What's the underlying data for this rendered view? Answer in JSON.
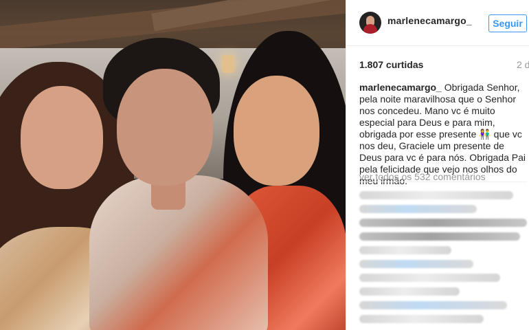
{
  "post": {
    "username": "marlenecamargo_",
    "follow_label": "Seguir",
    "likes_label": "1.807 curtidas",
    "date_label": "2 d",
    "caption_username": "marlenecamargo_",
    "caption_text": " Obrigada Senhor, pela noite maravilhosa que o Senhor nos concedeu. Mano vc é muito especial para Deus e para mim, obrigada por esse presente 👫 que vc nos deu, Graciele um presente de Deus para vc é para nós. Obrigada Pai pela felicidade que vejo nos olhos do meu irmão.",
    "view_all_comments": "ver todos os 532 comentários"
  },
  "colors": {
    "accent": "#3897f0",
    "text": "#262626",
    "muted": "#999999"
  }
}
